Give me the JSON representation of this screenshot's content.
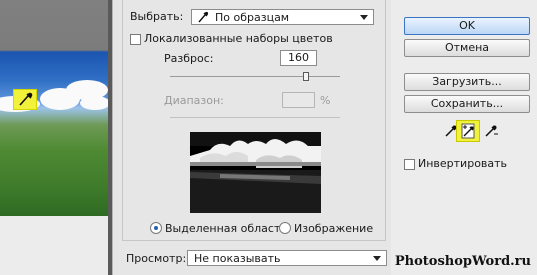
{
  "dialog": {
    "select_label": "Выбрать:",
    "select_value": "По образцам",
    "localized_label": "Локализованные наборы цветов",
    "fuzziness_label": "Разброс:",
    "fuzziness_value": "160",
    "fuzziness_level": 0.8,
    "range_label": "Диапазон:",
    "range_value": "",
    "range_unit": "%",
    "selection_option": "Выделенная область",
    "image_option": "Изображение",
    "preview_label": "Просмотр:",
    "preview_value": "Не показывать"
  },
  "buttons": {
    "ok": "OK",
    "cancel": "Отмена",
    "load": "Загрузить...",
    "save": "Сохранить...",
    "invert": "Инвертировать"
  },
  "tools": [
    "eyedropper-icon",
    "eyedropper-plus-icon",
    "eyedropper-minus-icon"
  ],
  "colors": {
    "highlight": "#f2f23a",
    "accent": "#2a5fb4"
  },
  "watermark": "PhotoshopWord.ru"
}
